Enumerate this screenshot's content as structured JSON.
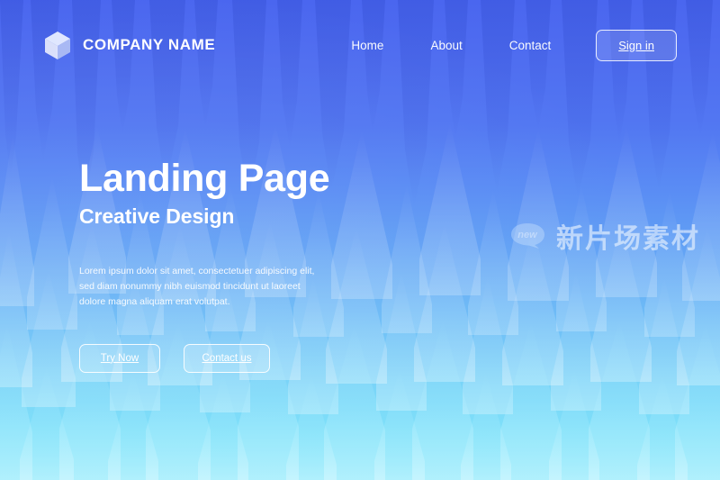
{
  "header": {
    "logo_icon": "cube-icon",
    "brand_name": "COMPANY NAME",
    "nav": [
      {
        "label": "Home"
      },
      {
        "label": "About"
      },
      {
        "label": "Contact"
      }
    ],
    "signin_label": "Sign in"
  },
  "hero": {
    "title": "Landing Page",
    "subtitle": "Creative Design",
    "paragraph": "Lorem ipsum dolor sit amet, consectetuer adipiscing elit, sed diam nonummy nibh euismod tincidunt ut laoreet dolore magna aliquam erat volutpat.",
    "primary_button": "Try Now",
    "secondary_button": "Contact us"
  },
  "watermark": {
    "badge_text": "new",
    "text": "新片场素材"
  },
  "colors": {
    "gradient_top": "#4a66ef",
    "gradient_mid": "#64a6f5",
    "gradient_bottom": "#83e6fa",
    "text_on_dark": "#ffffff"
  }
}
